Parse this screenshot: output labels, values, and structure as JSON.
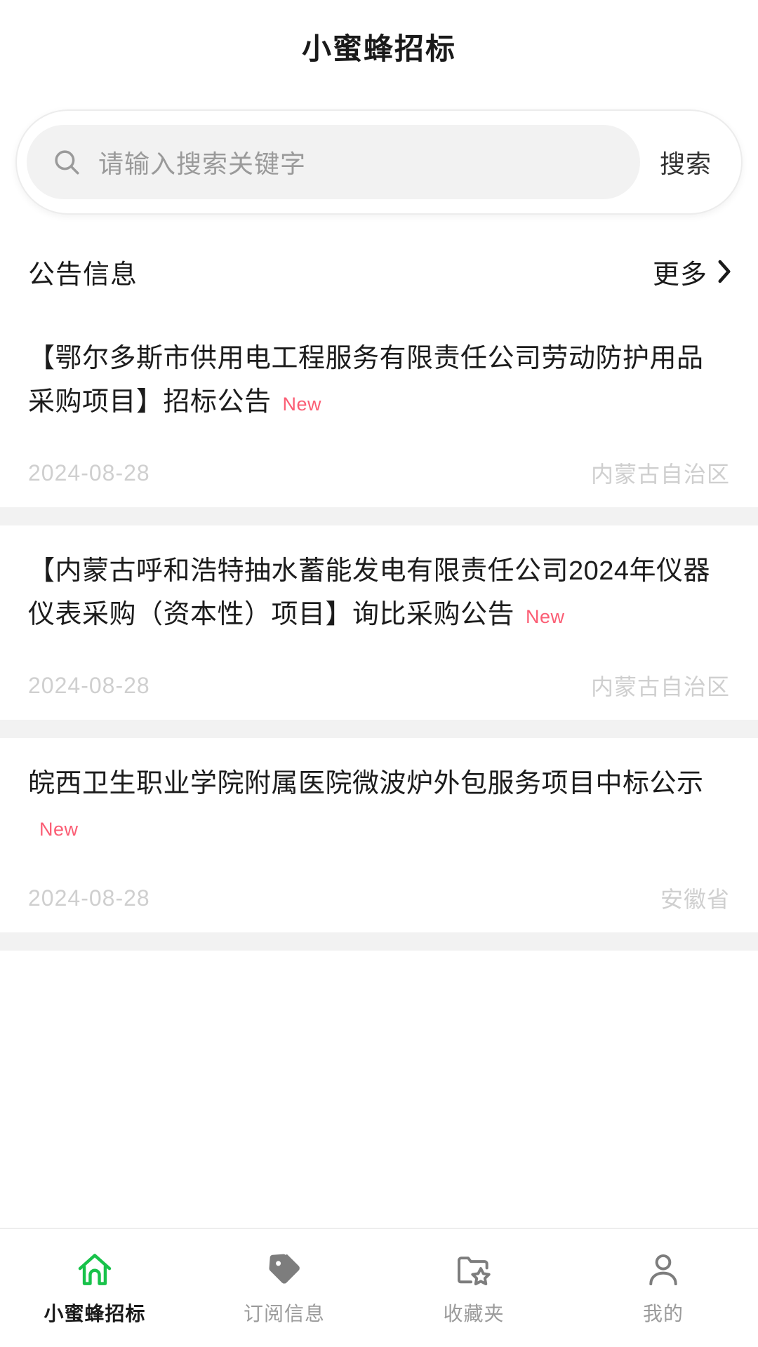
{
  "header": {
    "title": "小蜜蜂招标"
  },
  "search": {
    "placeholder": "请输入搜索关键字",
    "value": "",
    "button_label": "搜索",
    "icon": "search-icon"
  },
  "section": {
    "title": "公告信息",
    "more_label": "更多",
    "more_icon": "chevron-right-icon"
  },
  "news": [
    {
      "title": "【鄂尔多斯市供用电工程服务有限责任公司劳动防护用品采购项目】招标公告",
      "badge": "New",
      "date": "2024-08-28",
      "region": "内蒙古自治区"
    },
    {
      "title": "【内蒙古呼和浩特抽水蓄能发电有限责任公司2024年仪器仪表采购（资本性）项目】询比采购公告",
      "badge": "New",
      "date": "2024-08-28",
      "region": "内蒙古自治区"
    },
    {
      "title": "皖西卫生职业学院附属医院微波炉外包服务项目中标公示",
      "badge": "New",
      "date": "2024-08-28",
      "region": "安徽省"
    }
  ],
  "tabbar": [
    {
      "label": "小蜜蜂招标",
      "icon": "home-icon",
      "active": true
    },
    {
      "label": "订阅信息",
      "icon": "tag-icon",
      "active": false
    },
    {
      "label": "收藏夹",
      "icon": "folder-star-icon",
      "active": false
    },
    {
      "label": "我的",
      "icon": "person-icon",
      "active": false
    }
  ],
  "colors": {
    "accent_green": "#18c24a",
    "badge_red": "#fb5d74",
    "muted_gray": "#cfcfcf",
    "divider_gray": "#f2f2f2"
  }
}
